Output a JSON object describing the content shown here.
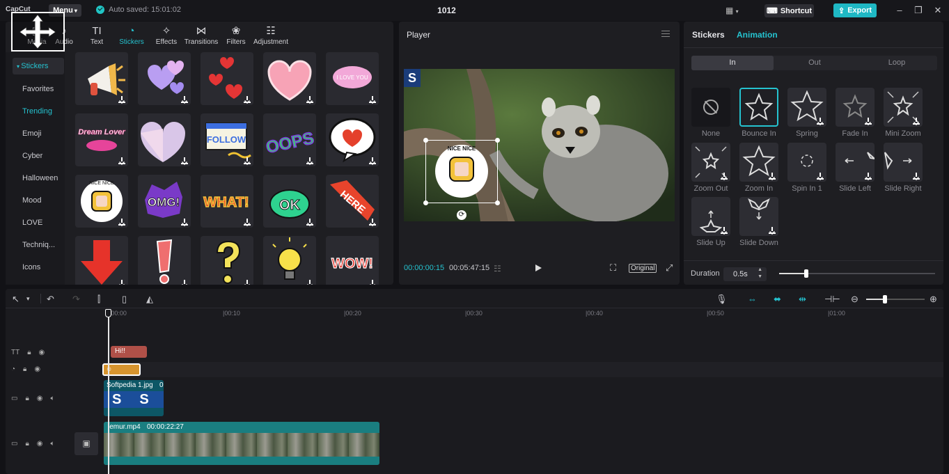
{
  "titlebar": {
    "app": "CapCut",
    "menu": "Menu",
    "autosave": "Auto saved: 15:01:02",
    "project": "1012",
    "shortcut": "Shortcut",
    "export": "Export"
  },
  "media": {
    "tabs": [
      "Media",
      "Audio",
      "Text",
      "Stickers",
      "Effects",
      "Transitions",
      "Filters",
      "Adjustment"
    ],
    "active_tab": "Stickers",
    "sidebar_header": "Stickers",
    "categories": [
      "Favorites",
      "Trending",
      "Emoji",
      "Cyber",
      "Halloween",
      "Mood",
      "LOVE",
      "Techniq...",
      "Icons"
    ],
    "active_category": "Trending",
    "stickers": [
      {
        "caption": ""
      },
      {
        "caption": ""
      },
      {
        "caption": ""
      },
      {
        "caption": ""
      },
      {
        "caption": "I LOVE YOU"
      },
      {
        "caption": "Dream Lover"
      },
      {
        "caption": ""
      },
      {
        "caption": "FOLLOW"
      },
      {
        "caption": "OOPS"
      },
      {
        "caption": ""
      },
      {
        "caption": "NICE NICE"
      },
      {
        "caption": "OMG!"
      },
      {
        "caption": "WHAT!"
      },
      {
        "caption": "OK"
      },
      {
        "caption": "HERE"
      },
      {
        "caption": ""
      },
      {
        "caption": ""
      },
      {
        "caption": ""
      },
      {
        "caption": ""
      },
      {
        "caption": "WOW!"
      }
    ]
  },
  "player": {
    "title": "Player",
    "current_time": "00:00:00:15",
    "total_time": "00:05:47:15",
    "original": "Original",
    "badge": "S",
    "sticker_text": "NICE NICE"
  },
  "animation": {
    "tabs": [
      "Stickers",
      "Animation"
    ],
    "active_tab": "Animation",
    "segments": [
      "In",
      "Out",
      "Loop"
    ],
    "active_segment": "In",
    "items": [
      "None",
      "Bounce In",
      "Spring",
      "Fade In",
      "Mini Zoom",
      "Zoom Out",
      "Zoom In",
      "Spin In 1",
      "Slide Left",
      "Slide Right",
      "Slide Up",
      "Slide Down"
    ],
    "selected": "Bounce In",
    "duration_label": "Duration",
    "duration_value": "0.5s"
  },
  "timeline": {
    "ruler": [
      "|00:00",
      "|00:10",
      "|00:20",
      "|00:30",
      "|00:40",
      "|00:50",
      "|01:00"
    ],
    "clips": {
      "text": "Hi!!",
      "image_name": "Softpedia 1.jpg",
      "image_dur": "0",
      "video_name": "lemur.mp4",
      "video_dur": "00:00:22:27"
    }
  },
  "colors": {
    "accent": "#25c3d0",
    "text_clip": "#b05048",
    "sticker_clip": "#d7942e",
    "image_clip": "#0d5766",
    "video_clip": "#1a7e80"
  }
}
